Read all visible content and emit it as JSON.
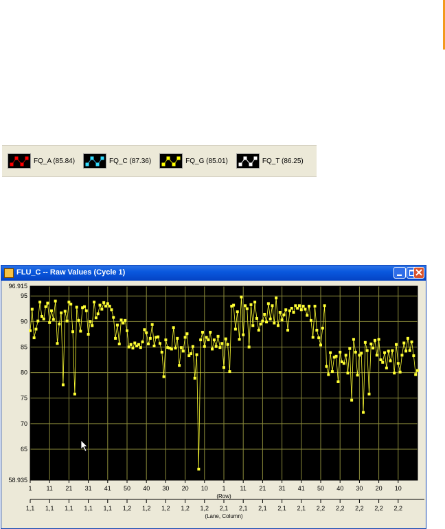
{
  "legend": {
    "items": [
      {
        "label": "FQ_A (85.84)",
        "line_color": "#cc0000",
        "marker_color": "#ff0000"
      },
      {
        "label": "FQ_C (87.36)",
        "line_color": "#33aadd",
        "marker_color": "#33ddff"
      },
      {
        "label": "FQ_G (85.01)",
        "line_color": "#cccc00",
        "marker_color": "#ffff00"
      },
      {
        "label": "FQ_T (86.25)",
        "line_color": "#ffffff",
        "marker_color": "#ffffff"
      }
    ]
  },
  "window": {
    "title": "FLU_C  -- Raw Values (Cycle 1)",
    "icons": {
      "minimize": "minimize-icon",
      "maximize": "maximize-icon",
      "close": "close-icon"
    }
  },
  "chart_data": {
    "type": "line",
    "title": "",
    "xlabel": "(Row)",
    "xlabel2": "(Lane, Column)",
    "ylabel": "",
    "ylim": [
      58.935,
      96.915
    ],
    "ytick_labels": [
      "96.915",
      "95",
      "90",
      "85",
      "80",
      "75",
      "70",
      "65",
      "58.935"
    ],
    "ytick_values": [
      96.915,
      95,
      90,
      85,
      80,
      75,
      70,
      65,
      58.935
    ],
    "x_ticks_row": [
      "1",
      "11",
      "21",
      "31",
      "41",
      "50",
      "40",
      "30",
      "20",
      "10",
      "1",
      "11",
      "21",
      "31",
      "41",
      "50",
      "40",
      "30",
      "20",
      "10"
    ],
    "x_ticks_lane_column": [
      "1,1",
      "1,1",
      "1,1",
      "1,1",
      "1,1",
      "1,2",
      "1,2",
      "1,2",
      "1,2",
      "1,2",
      "2,1",
      "2,1",
      "2,1",
      "2,1",
      "2,1",
      "2,2",
      "2,2",
      "2,2",
      "2,2",
      "2,2"
    ],
    "grid": true,
    "background": "#000000",
    "grid_color": "#8a8a3a",
    "series": [
      {
        "name": "FLU_C",
        "color": "#ffff33",
        "values": [
          88.2,
          92.4,
          86.8,
          88.5,
          90.1,
          93.8,
          91.0,
          90.5,
          92.9,
          93.6,
          89.8,
          92.1,
          90.4,
          94.0,
          85.7,
          89.5,
          91.7,
          77.6,
          92.0,
          90.1,
          93.8,
          93.4,
          88.0,
          75.8,
          92.8,
          90.2,
          88.1,
          92.7,
          92.9,
          92.1,
          87.5,
          90.0,
          89.2,
          93.8,
          90.7,
          91.5,
          93.2,
          92.4,
          93.7,
          93.0,
          93.5,
          93.0,
          92.3,
          90.8,
          86.7,
          89.3,
          85.6,
          90.3,
          89.7,
          90.2,
          88.2,
          85.0,
          85.5,
          84.8,
          85.8,
          85.2,
          85.5,
          84.9,
          86.0,
          88.4,
          87.8,
          85.6,
          86.7,
          89.4,
          85.2,
          86.9,
          87.0,
          85.7,
          84.0,
          79.2,
          86.4,
          84.9,
          84.8,
          84.6,
          88.8,
          84.8,
          86.7,
          81.4,
          84.9,
          84.2,
          86.9,
          87.6,
          83.3,
          83.7,
          85.1,
          78.9,
          83.5,
          61.1,
          86.4,
          87.9,
          85.1,
          86.9,
          86.4,
          87.9,
          84.6,
          86.4,
          85.1,
          87.1,
          84.9,
          85.7,
          81.0,
          86.6,
          85.5,
          80.2,
          93.0,
          93.2,
          88.5,
          91.9,
          86.5,
          94.8,
          87.4,
          93.1,
          92.5,
          85.0,
          93.3,
          89.2,
          93.8,
          90.6,
          88.3,
          89.5,
          90.1,
          91.4,
          89.9,
          93.5,
          90.5,
          93.1,
          89.7,
          94.6,
          89.2,
          91.8,
          90.3,
          91.3,
          92.3,
          88.3,
          92.1,
          92.6,
          91.8,
          93.1,
          92.6,
          93.1,
          92.3,
          93.0,
          92.4,
          91.2,
          93.0,
          90.2,
          86.9,
          93.0,
          88.3,
          86.8,
          85.4,
          88.7,
          93.1,
          81.2,
          79.6,
          83.9,
          80.2,
          83.0,
          83.2,
          78.2,
          84.0,
          82.1,
          81.8,
          83.4,
          79.9,
          84.7,
          74.6,
          86.5,
          84.0,
          79.5,
          83.4,
          83.8,
          72.2,
          85.9,
          84.3,
          75.8,
          85.6,
          84.8,
          86.3,
          83.4,
          86.5,
          82.5,
          82.0,
          83.9,
          80.9,
          84.2,
          82.3,
          84.3,
          79.9,
          85.5,
          81.8,
          80.1,
          83.4,
          85.8,
          84.2,
          86.7,
          84.3,
          86.0,
          83.3,
          79.6,
          80.4
        ]
      }
    ]
  },
  "cursor": {
    "name": "mouse-pointer-icon"
  }
}
